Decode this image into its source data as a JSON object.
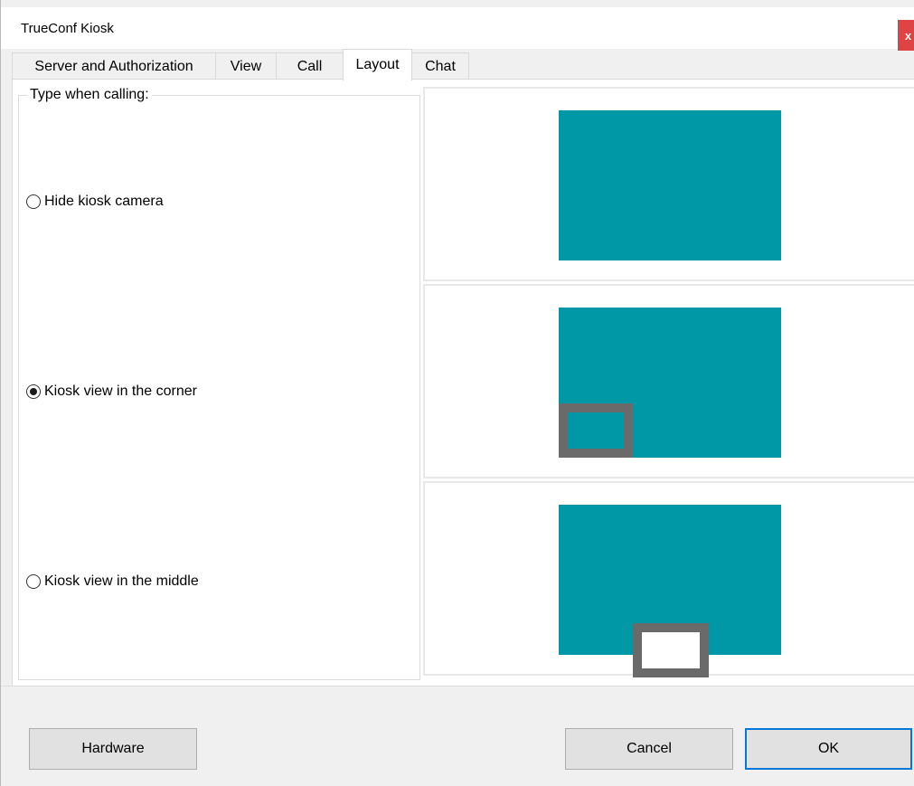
{
  "window": {
    "title": "TrueConf Kiosk",
    "close_label": "x"
  },
  "tabs": [
    {
      "label": "Server and Authorization"
    },
    {
      "label": "View"
    },
    {
      "label": "Call"
    },
    {
      "label": "Layout"
    },
    {
      "label": "Chat"
    }
  ],
  "active_tab": "Layout",
  "layout_group": {
    "title": "Type when calling:",
    "options": [
      {
        "label": "Hide kiosk camera",
        "selected": false
      },
      {
        "label": "Kiosk view in the corner",
        "selected": true
      },
      {
        "label": "Kiosk view in the middle",
        "selected": false
      }
    ]
  },
  "colors": {
    "screen": "#0097a7",
    "pip_frame": "#6a6a6a",
    "accent": "#0078d7"
  },
  "footer": {
    "hardware_label": "Hardware",
    "cancel_label": "Cancel",
    "ok_label": "OK"
  }
}
